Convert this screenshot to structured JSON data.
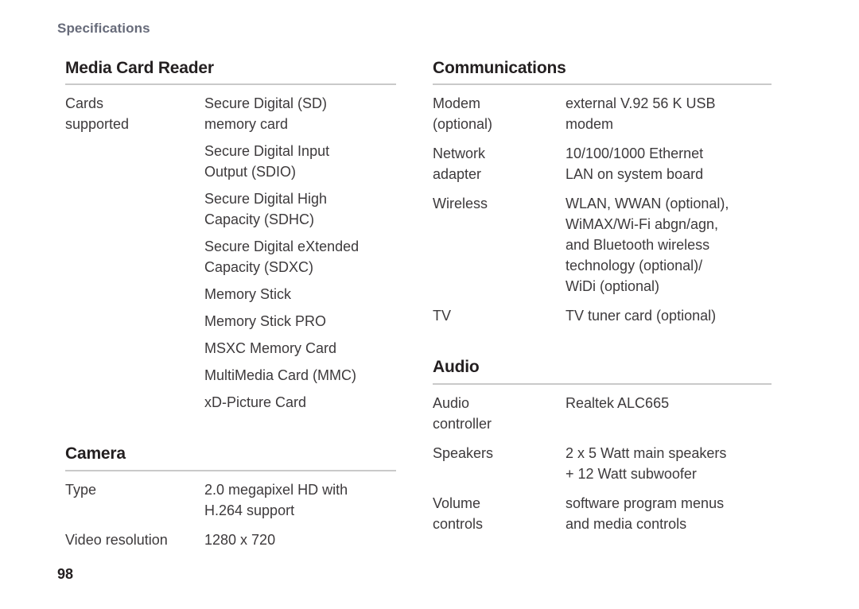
{
  "running_head": "Specifications",
  "folio": "98",
  "colors": {
    "running_head": "#676b7a",
    "heading": "#231f20",
    "body": "#3d3a3c",
    "rule": "#c9c9c9"
  },
  "left_column": {
    "sections": [
      {
        "title": "Media Card Reader",
        "rows": [
          {
            "label": "Cards\nsupported",
            "values": [
              "Secure Digital (SD)\nmemory card",
              "Secure Digital Input\nOutput (SDIO)",
              "Secure Digital High\nCapacity (SDHC)",
              "Secure Digital eXtended\nCapacity (SDXC)",
              "Memory Stick",
              "Memory Stick PRO",
              "MSXC Memory Card",
              "MultiMedia Card (MMC)",
              "xD-Picture Card"
            ]
          }
        ]
      },
      {
        "title": "Camera",
        "rows": [
          {
            "label": "Type",
            "value": "2.0 megapixel HD with\nH.264 support"
          },
          {
            "label": "Video resolution",
            "value": "1280 x 720",
            "wide_label": true
          }
        ]
      }
    ]
  },
  "right_column": {
    "sections": [
      {
        "title": "Communications",
        "rows": [
          {
            "label": "Modem\n(optional)",
            "value": "external V.92 56 K USB\nmodem"
          },
          {
            "label": "Network\nadapter",
            "value": "10/100/1000 Ethernet\nLAN on system board"
          },
          {
            "label": "Wireless",
            "value": "WLAN, WWAN (optional),\nWiMAX/Wi-Fi abgn/agn,\nand Bluetooth wireless\ntechnology (optional)/\nWiDi (optional)"
          },
          {
            "label": "TV",
            "value": "TV tuner card (optional)"
          }
        ]
      },
      {
        "title": "Audio",
        "rows": [
          {
            "label": "Audio\ncontroller",
            "value": "Realtek ALC665"
          },
          {
            "label": "Speakers",
            "value": "2 x 5 Watt main speakers\n+ 12 Watt subwoofer"
          },
          {
            "label": "Volume\ncontrols",
            "value": "software program menus\nand media controls"
          }
        ]
      }
    ]
  }
}
